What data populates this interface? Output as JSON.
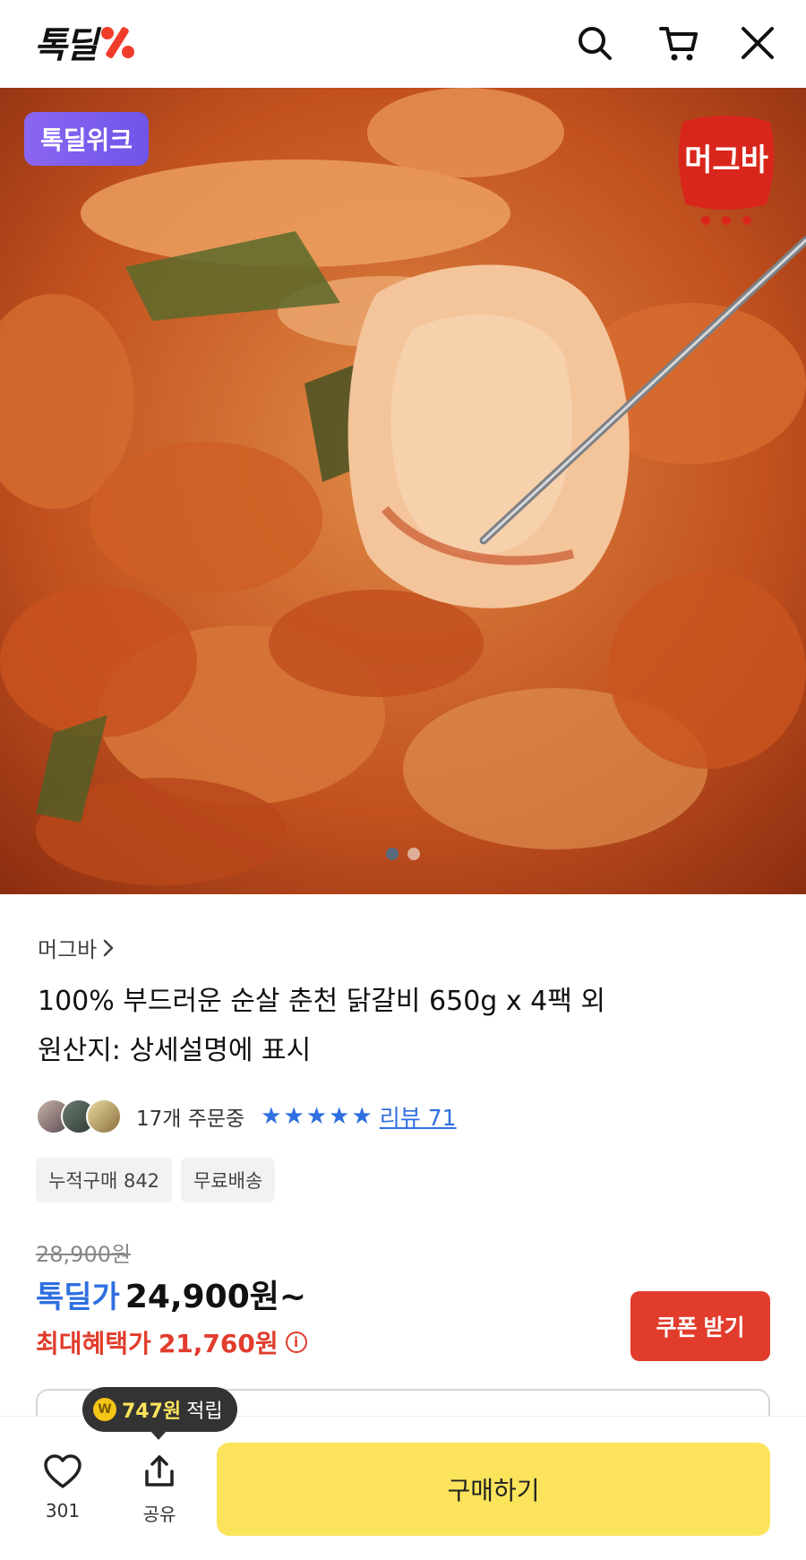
{
  "header": {
    "logo_text": "톡딜",
    "icons": [
      "search-icon",
      "cart-icon",
      "close-icon"
    ]
  },
  "hero": {
    "badge": "톡딜위크",
    "brand_logo_text": "머그바",
    "slide_count": 2,
    "active_slide": 1
  },
  "product": {
    "brand": "머그바",
    "title": "100% 부드러운 순살 춘천 닭갈비 650g x 4팩 외",
    "origin": "원산지: 상세설명에 표시",
    "orders": "17개 주문중",
    "rating_stars": 5,
    "review_link": "리뷰 71",
    "tags": [
      "누적구매 842",
      "무료배송"
    ],
    "original_price": "28,900원",
    "price_label": "톡딜가",
    "price": "24,900원~",
    "max_benefit_label": "최대혜택가",
    "max_benefit_price": "21,760원",
    "coupon_button": "쿠폰 받기"
  },
  "bottom_bar": {
    "likes": "301",
    "share_label": "공유",
    "buy_button": "구매하기",
    "points_amount": "747원",
    "points_suffix": "적립"
  },
  "colors": {
    "accent_blue": "#2f6fe0",
    "accent_red": "#e13c2c",
    "buy_yellow": "#fbe45b",
    "badge_purple": "#7a5cf0"
  }
}
